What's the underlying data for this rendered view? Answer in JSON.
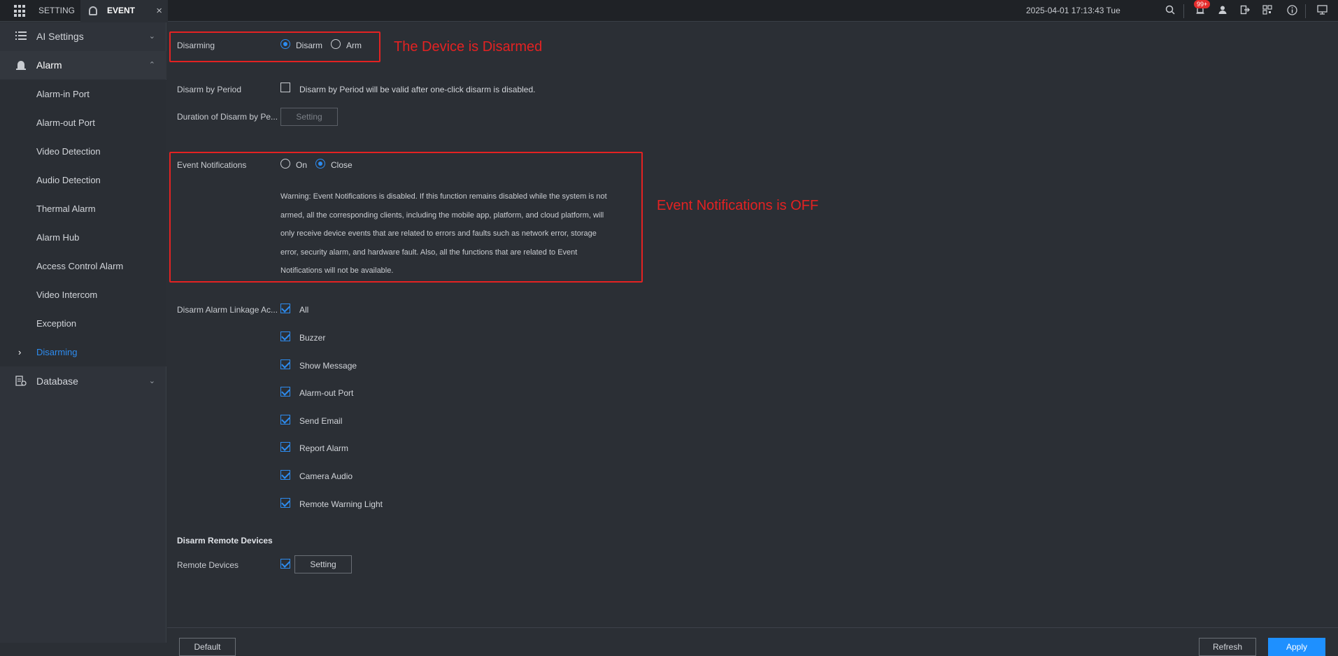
{
  "topbar": {
    "tabs": [
      "SETTING",
      "EVENT"
    ],
    "close_glyph": "×",
    "datetime": "2025-04-01 17:13:43 Tue",
    "badge": "99+",
    "icons": [
      "grid-icon",
      "search-icon",
      "alarm-bell-icon",
      "user-icon",
      "logout-icon",
      "qr-code-icon",
      "info-icon",
      "display-icon"
    ]
  },
  "sidebar": {
    "items": [
      {
        "label": "AI Settings",
        "icon": "list-icon",
        "expanded": false
      },
      {
        "label": "Alarm",
        "icon": "alarm-icon",
        "expanded": true
      },
      {
        "label": "Database",
        "icon": "database-icon",
        "expanded": false
      }
    ],
    "alarm_sub": [
      "Alarm-in Port",
      "Alarm-out Port",
      "Video Detection",
      "Audio Detection",
      "Thermal Alarm",
      "Alarm Hub",
      "Access Control Alarm",
      "Video Intercom",
      "Exception",
      "Disarming"
    ],
    "active_sub": "Disarming",
    "accent_color": "#2d8cf0"
  },
  "form": {
    "disarming": {
      "label": "Disarming",
      "options": [
        "Disarm",
        "Arm"
      ],
      "selected": "Disarm"
    },
    "disarm_by_period": {
      "label": "Disarm by Period",
      "checked": false,
      "hint": "Disarm by Period will be valid after one-click disarm is disabled."
    },
    "duration": {
      "label": "Duration of Disarm by Pe...",
      "button": "Setting"
    },
    "event_notifications": {
      "label": "Event Notifications",
      "options": [
        "On",
        "Close"
      ],
      "selected": "Close",
      "warning_lines": [
        "Warning: Event Notifications is disabled. If this function remains disabled while the system is not",
        "armed, all the corresponding clients, including the mobile app, platform, and cloud platform, will",
        "only receive device events that are related to errors and faults such as network error, storage",
        "error, security alarm, and hardware fault. Also, all the functions that are related to Event",
        "Notifications will not be available."
      ]
    },
    "linkage": {
      "label": "Disarm Alarm Linkage Ac...",
      "items": [
        "All",
        "Buzzer",
        "Show Message",
        "Alarm-out Port",
        "Send Email",
        "Report Alarm",
        "Camera Audio",
        "Remote Warning Light"
      ],
      "all_checked": true
    },
    "remote": {
      "section_title": "Disarm Remote Devices",
      "label": "Remote Devices",
      "checked": true,
      "button": "Setting"
    }
  },
  "annotations": {
    "disarmed": "The Device is Disarmed",
    "notifications": "Event Notifications is OFF",
    "color": "#e32222"
  },
  "footer": {
    "default": "Default",
    "refresh": "Refresh",
    "apply": "Apply"
  }
}
